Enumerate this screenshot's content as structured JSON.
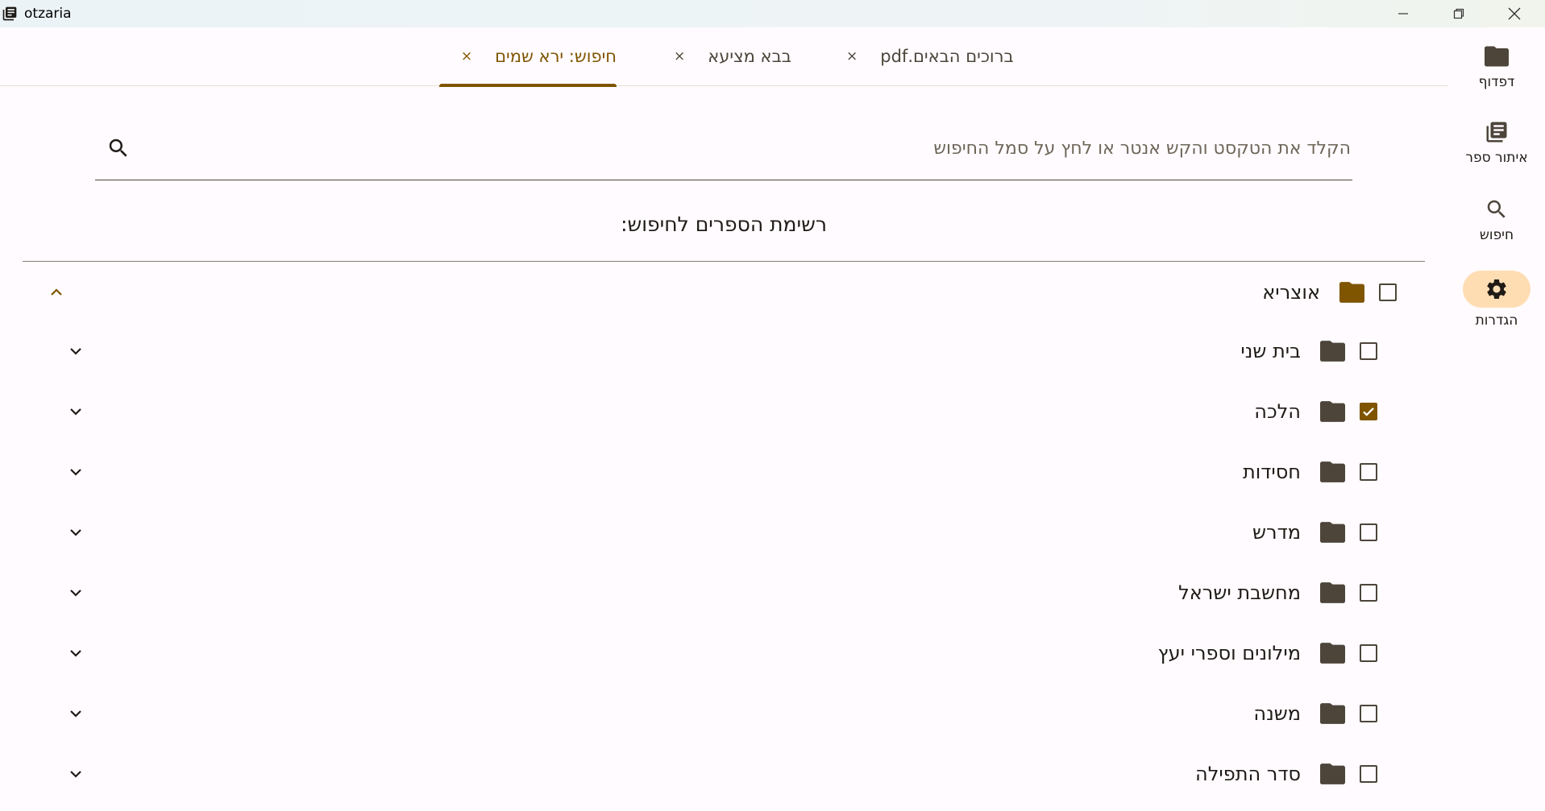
{
  "window": {
    "title": "otzaria"
  },
  "tabs": [
    {
      "label": "ברוכים הבאים.pdf",
      "close": "×",
      "active": false
    },
    {
      "label": "בבא מציעא",
      "close": "×",
      "active": false
    },
    {
      "label": "חיפוש: ירא שמים",
      "close": "×",
      "active": true
    }
  ],
  "nav": [
    {
      "label": "דפדוף",
      "icon": "folder-icon",
      "selected": false
    },
    {
      "label": "איתור ספר",
      "icon": "library-books-icon",
      "selected": false
    },
    {
      "label": "חיפוש",
      "icon": "search-icon",
      "selected": false
    },
    {
      "label": "הגדרות",
      "icon": "gear-icon",
      "selected": true
    }
  ],
  "search": {
    "placeholder": "הקלד את הטקסט והקש אנטר או לחץ על סמל החיפוש",
    "value": ""
  },
  "list_title": "רשימת הספרים לחיפוש:",
  "tree": {
    "root": {
      "label": "אוצריא",
      "checked": false,
      "expanded": true
    },
    "children": [
      {
        "label": "בית שני",
        "checked": false,
        "expanded": false
      },
      {
        "label": "הלכה",
        "checked": true,
        "expanded": false
      },
      {
        "label": "חסידות",
        "checked": false,
        "expanded": false
      },
      {
        "label": "מדרש",
        "checked": false,
        "expanded": false
      },
      {
        "label": "מחשבת ישראל",
        "checked": false,
        "expanded": false
      },
      {
        "label": "מילונים וספרי יעץ",
        "checked": false,
        "expanded": false
      },
      {
        "label": "משנה",
        "checked": false,
        "expanded": false
      },
      {
        "label": "סדר התפילה",
        "checked": false,
        "expanded": false
      }
    ]
  },
  "colors": {
    "accent": "#7f5500",
    "folder_root": "#7f5500",
    "folder": "#4d453a",
    "rail_selected": "#ffddb3"
  }
}
